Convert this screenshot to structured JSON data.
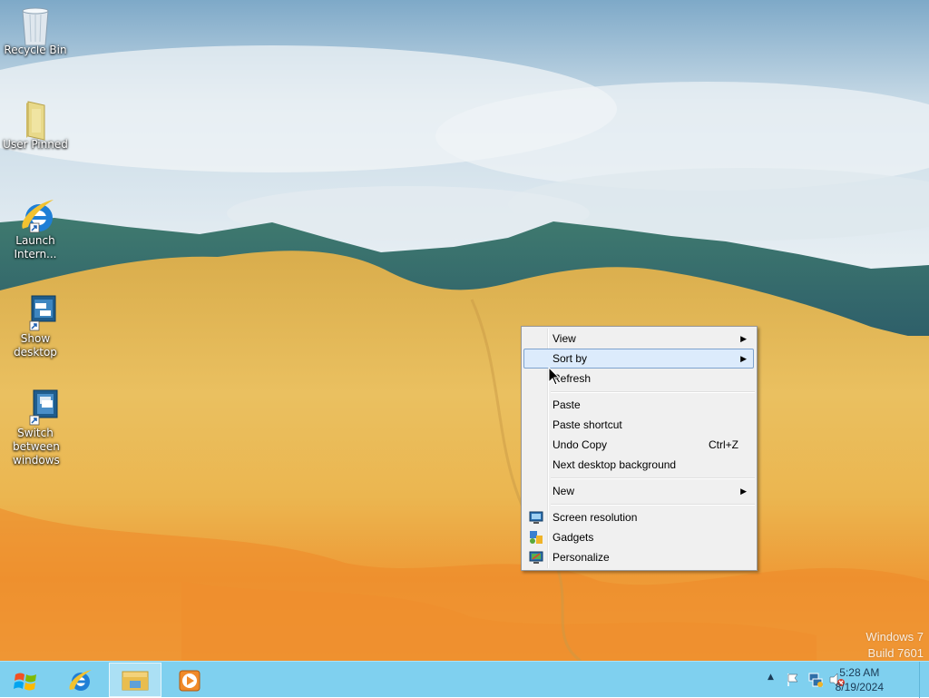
{
  "desktop_icons": [
    {
      "label": "Recycle Bin",
      "icon": "recycle-bin-icon"
    },
    {
      "label": "User Pinned",
      "icon": "folder-icon"
    },
    {
      "label": "Launch Intern...",
      "icon": "internet-explorer-icon"
    },
    {
      "label": "Show desktop",
      "icon": "show-desktop-icon"
    },
    {
      "label": "Switch between windows",
      "icon": "switch-windows-icon"
    }
  ],
  "context_menu": {
    "items": [
      {
        "label": "View",
        "submenu": true
      },
      {
        "label": "Sort by",
        "submenu": true,
        "highlighted": true
      },
      {
        "label": "Refresh"
      },
      {
        "label": "Paste"
      },
      {
        "label": "Paste shortcut"
      },
      {
        "label": "Undo Copy",
        "shortcut": "Ctrl+Z"
      },
      {
        "label": "Next desktop background"
      },
      {
        "label": "New",
        "submenu": true
      },
      {
        "label": "Screen resolution",
        "icon": "screen-resolution-icon"
      },
      {
        "label": "Gadgets",
        "icon": "gadgets-icon"
      },
      {
        "label": "Personalize",
        "icon": "personalize-icon"
      }
    ]
  },
  "taskbar": {
    "start": "start-button-icon",
    "pinned": [
      "internet-explorer-icon",
      "file-explorer-icon",
      "media-player-icon"
    ],
    "tray_icons": [
      "show-hidden-icons-arrow",
      "action-center-flag-icon",
      "network-icon",
      "volume-muted-icon"
    ],
    "time": "5:28 AM",
    "date": "8/19/2024"
  },
  "watermark": {
    "line1": "Windows 7",
    "line2": "Build 7601"
  },
  "colors": {
    "taskbar": "#7fd0ef",
    "menu_bg": "#f0f0f0",
    "menu_highlight": "#dcebfc"
  }
}
